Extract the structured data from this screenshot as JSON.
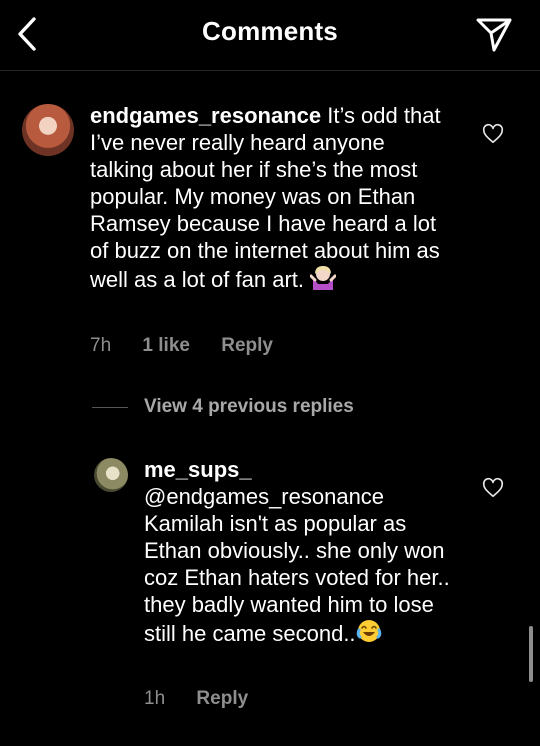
{
  "header": {
    "title": "Comments"
  },
  "comments": [
    {
      "username": "endgames_resonance",
      "text": "It’s odd that I’ve never really heard anyone talking about her if she’s the most popular. My money was on Ethan Ramsey because I have heard a lot of buzz on the internet about him as well as a lot of fan art.",
      "emoji": "person-shrugging",
      "time": "7h",
      "likes": "1 like",
      "reply_label": "Reply"
    },
    {
      "username": "me_sups_",
      "mention": "@endgames_resonance",
      "text": "Kamilah isn't as popular as Ethan obviously.. she only won coz Ethan haters voted for her.. they badly wanted him to lose still he came second..",
      "emoji": "face-with-tears-of-joy",
      "time": "1h",
      "reply_label": "Reply"
    }
  ],
  "view_replies_label": "View 4 previous replies",
  "icons": {
    "back": "chevron-left-icon",
    "send": "send-icon",
    "like": "heart-icon"
  }
}
